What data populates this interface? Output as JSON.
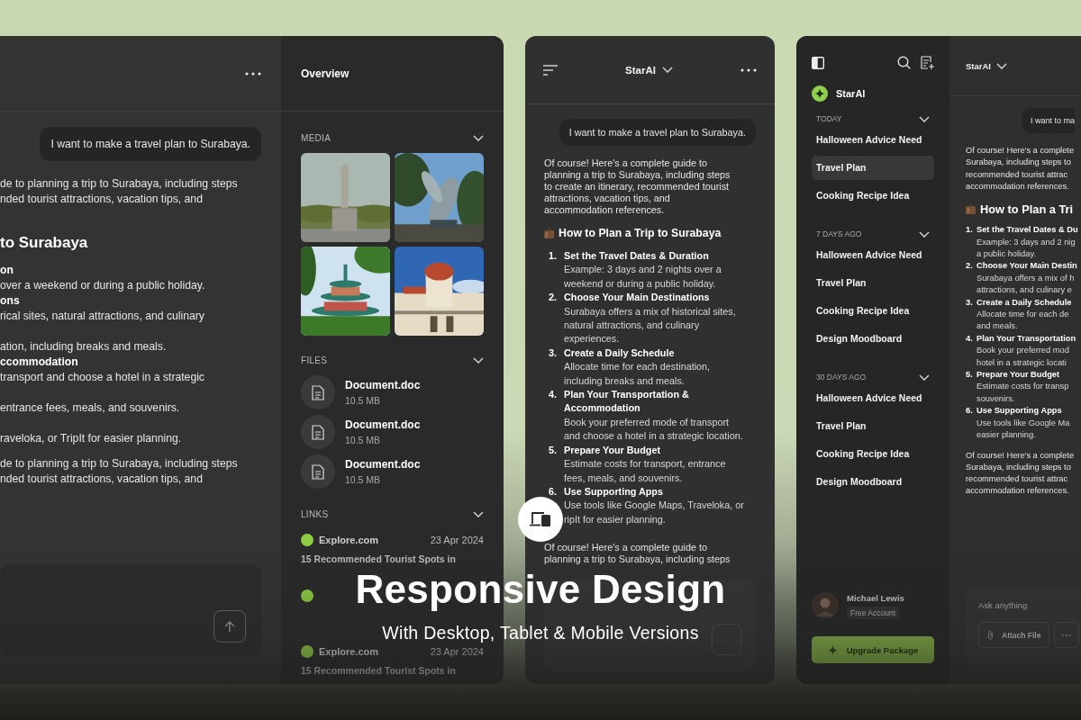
{
  "banner": {
    "title": "Responsive Design",
    "subtitle": "With Desktop, Tablet & Mobile Versions"
  },
  "desktop": {
    "chat": {
      "user_message": "I want to make a travel plan to Surabaya.",
      "intro": [
        "de to planning a trip to Surabaya, including steps",
        "nded tourist attractions, vacation tips, and"
      ],
      "heading": "to Surabaya",
      "list": [
        {
          "kind": "title",
          "text": "on"
        },
        {
          "kind": "text",
          "text": "over a weekend or during a public holiday."
        },
        {
          "kind": "title",
          "text": "ons"
        },
        {
          "kind": "text",
          "text": "rical sites, natural attractions, and culinary"
        },
        {
          "kind": "gap"
        },
        {
          "kind": "text",
          "text": "ation, including breaks and meals."
        },
        {
          "kind": "title",
          "text": "ccommodation"
        },
        {
          "kind": "text",
          "text": "transport and choose a hotel in a strategic"
        },
        {
          "kind": "gap"
        },
        {
          "kind": "text",
          "text": "entrance fees, meals, and souvenirs."
        },
        {
          "kind": "gap"
        },
        {
          "kind": "text",
          "text": "raveloka, or TripIt for easier planning."
        }
      ],
      "outro": [
        "de to planning a trip to Surabaya, including steps",
        "nded tourist attractions, vacation tips, and"
      ]
    },
    "overview": {
      "title": "Overview",
      "media_label": "MEDIA",
      "files_label": "FILES",
      "files": [
        {
          "name": "Document.doc",
          "size": "10.5 MB"
        },
        {
          "name": "Document.doc",
          "size": "10.5 MB"
        },
        {
          "name": "Document.doc",
          "size": "10.5 MB"
        }
      ],
      "links_label": "LINKS",
      "links": [
        {
          "kind": "link",
          "site": "Explore.com",
          "date": "23 Apr 2024",
          "title": [
            "15 Recommended Tourist Spots in"
          ]
        },
        {
          "kind": "partly_hidden"
        },
        {
          "kind": "link",
          "site": "Explore.com",
          "date": "23 Apr 2024",
          "title": [
            "15 Recommended Tourist Spots in"
          ]
        }
      ]
    }
  },
  "tablet": {
    "app_name": "StarAI",
    "user_message": "I want to make a travel plan to Surabaya.",
    "intro": [
      "Of course! Here's a complete guide to",
      "planning a trip to Surabaya, including steps",
      "to create an itinerary, recommended tourist",
      "attractions, vacation tips, and",
      "accommodation references."
    ],
    "heading": "How to Plan a Trip to Surabaya",
    "steps": [
      {
        "number": "1.",
        "title": [
          "Set the Travel Dates & Duration"
        ],
        "body": [
          "Example: 3 days and 2 nights over a",
          "weekend or during a public holiday."
        ]
      },
      {
        "number": "2.",
        "title": [
          "Choose Your Main Destinations"
        ],
        "body": [
          "Surabaya offers a mix of historical sites,",
          "natural attractions, and culinary",
          "experiences."
        ]
      },
      {
        "number": "3.",
        "title": [
          "Create a Daily Schedule"
        ],
        "body": [
          "Allocate time for each destination,",
          "including breaks and meals."
        ]
      },
      {
        "number": "4.",
        "title": [
          "Plan Your Transportation &",
          "Accommodation"
        ],
        "body": [
          "Book your preferred mode of transport",
          "and choose a hotel in a strategic location."
        ]
      },
      {
        "number": "5.",
        "title": [
          "Prepare Your Budget"
        ],
        "body": [
          "Estimate costs for transport, entrance",
          "fees, meals, and souvenirs."
        ]
      },
      {
        "number": "6.",
        "title": [
          "Use Supporting Apps"
        ],
        "body": [
          "Use tools like Google Maps, Traveloka, or",
          "ripIt for easier planning."
        ]
      }
    ],
    "outro": [
      "Of course! Here's a complete guide to",
      "planning a trip to Surabaya, including steps"
    ]
  },
  "desktop_with_sidebar": {
    "sidebar": {
      "app_name": "StarAI",
      "groups": [
        {
          "label": "TODAY",
          "items": [
            {
              "label": "Halloween Advice Need",
              "selected": false
            },
            {
              "label": "Travel Plan",
              "selected": true
            },
            {
              "label": "Cooking Recipe Idea",
              "selected": false
            }
          ]
        },
        {
          "label": "7 DAYS AGO",
          "items": [
            {
              "label": "Halloween Advice Need",
              "selected": false
            },
            {
              "label": "Travel Plan",
              "selected": false
            },
            {
              "label": "Cooking Recipe Idea",
              "selected": false
            },
            {
              "label": "Design Moodboard",
              "selected": false
            }
          ]
        },
        {
          "label": "30 DAYS AGO",
          "items": [
            {
              "label": "Halloween Advice Need",
              "selected": false
            },
            {
              "label": "Travel Plan",
              "selected": false
            },
            {
              "label": "Cooking Recipe Idea",
              "selected": false
            },
            {
              "label": "Design Moodboard",
              "selected": false
            }
          ]
        }
      ],
      "user": {
        "name": "Michael Lewis",
        "plan": "Free Account"
      },
      "upgrade_button": "Upgrade Package"
    },
    "chat": {
      "app_name": "StarAI",
      "user_message": "I want to ma",
      "intro": [
        "Of course! Here's a complete",
        "Surabaya, including steps to",
        "recommended tourist attrac",
        "accommodation references."
      ],
      "heading": "How to Plan a Tri",
      "steps": [
        {
          "number": "1.",
          "title": [
            "Set the Travel Dates & Du"
          ],
          "body": [
            "Example: 3 days and 2 nig",
            "a public holiday."
          ]
        },
        {
          "number": "2.",
          "title": [
            "Choose Your Main Destin"
          ],
          "body": [
            "Surabaya offers a mix of h",
            "attractions, and culinary e"
          ]
        },
        {
          "number": "3.",
          "title": [
            "Create a Daily Schedule"
          ],
          "body": [
            "Allocate time for each de",
            "and meals."
          ]
        },
        {
          "number": "4.",
          "title": [
            "Plan Your Transportation"
          ],
          "body": [
            "Book your preferred mod",
            "hotel in a strategic locati"
          ]
        },
        {
          "number": "5.",
          "title": [
            "Prepare Your Budget"
          ],
          "body": [
            "Estimate costs for transp",
            "souvenirs."
          ]
        },
        {
          "number": "6.",
          "title": [
            "Use Supporting Apps"
          ],
          "body": [
            "Use tools like Google Ma",
            "easier planning."
          ]
        }
      ],
      "outro": [
        "Of course! Here's a complete",
        "Surabaya, including steps to",
        "recommended tourist attrac",
        "accommodation references."
      ],
      "input_placeholder": "Ask anything",
      "attach_button": "Attach File"
    }
  }
}
